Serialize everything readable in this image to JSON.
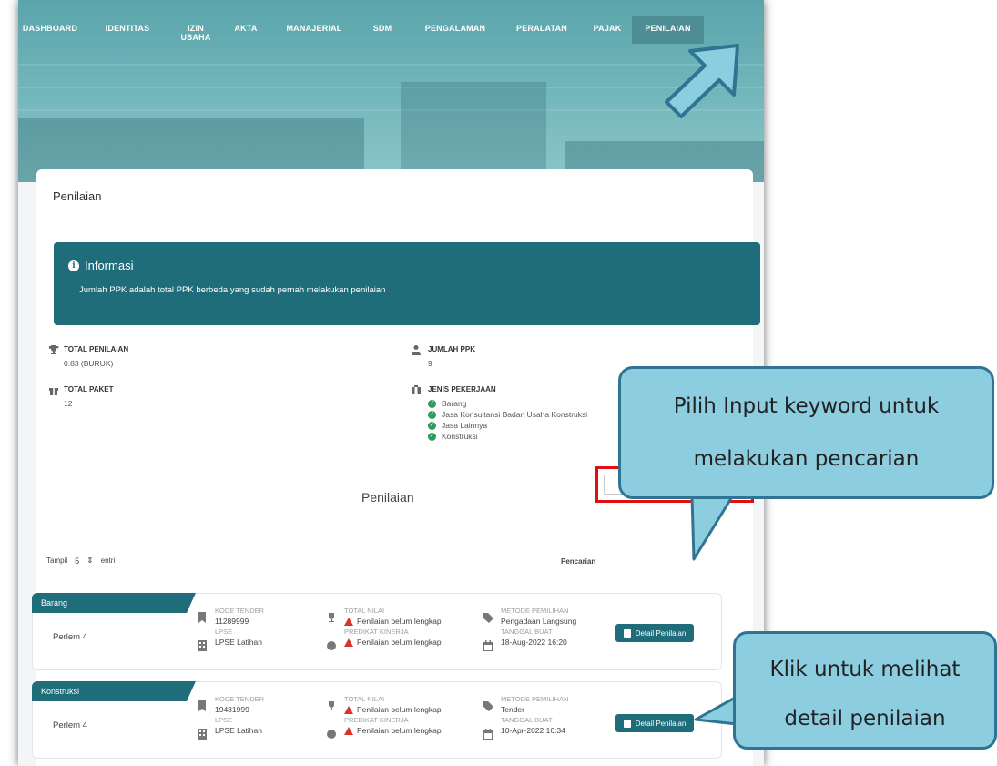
{
  "nav": {
    "items": [
      "DASHBOARD",
      "IDENTITAS",
      "IZIN\nUSAHA",
      "AKTA",
      "MANAJERIAL",
      "SDM",
      "PENGALAMAN",
      "PERALATAN",
      "PAJAK",
      "PENILAIAN"
    ],
    "active": "PENILAIAN"
  },
  "panel": {
    "title": "Penilaian"
  },
  "info": {
    "title": "Informasi",
    "text": "Jumlah PPK adalah total PPK berbeda yang sudah pernah melakukan penilaian"
  },
  "stats": {
    "total_penilaian_label": "TOTAL PENILAIAN",
    "total_penilaian_value": "0.83 (BURUK)",
    "jumlah_ppk_label": "JUMLAH PPK",
    "jumlah_ppk_value": "9",
    "total_paket_label": "TOTAL PAKET",
    "total_paket_value": "12",
    "jenis_label": "JENIS PEKERJAAN",
    "jenis_items": [
      "Barang",
      "Jasa Konsultansi Badan Usaha Konstruksi",
      "Jasa Lainnya",
      "Konstruksi"
    ]
  },
  "section": {
    "title": "Penilaian",
    "show_label": "Tampil",
    "show_value": "5",
    "show_suffix": "entri",
    "search_label": "Pencarian",
    "search_value": ""
  },
  "cards": [
    {
      "category": "Barang",
      "package": "Perlem 4",
      "kode_label": "KODE TENDER",
      "kode_value": "11289999",
      "lpse_label": "LPSE",
      "lpse_value": "LPSE Latihan",
      "nilai_label": "TOTAL NILAI",
      "nilai_value": "Penilaian belum lengkap",
      "predikat_label": "PREDIKAT KINERJA",
      "predikat_value": "Penilaian belum lengkap",
      "metode_label": "METODE PEMILIHAN",
      "metode_value": "Pengadaan Langsung",
      "tanggal_label": "TANGGAL BUAT",
      "tanggal_value": "18-Aug-2022 16:20",
      "button": "Detail Penilaian"
    },
    {
      "category": "Konstruksi",
      "package": "Perlem 4",
      "kode_label": "KODE TENDER",
      "kode_value": "19481999",
      "lpse_label": "LPSE",
      "lpse_value": "LPSE Latihan",
      "nilai_label": "TOTAL NILAI",
      "nilai_value": "Penilaian belum lengkap",
      "predikat_label": "PREDIKAT KINERJA",
      "predikat_value": "Penilaian belum lengkap",
      "metode_label": "METODE PEMILIHAN",
      "metode_value": "Tender",
      "tanggal_label": "TANGGAL BUAT",
      "tanggal_value": "10-Apr-2022 16:34",
      "button": "Detail Penilaian"
    }
  ],
  "callouts": {
    "search": {
      "line1": "Pilih Input keyword untuk",
      "line2": "melakukan pencarian"
    },
    "detail": {
      "line1": "Klik untuk melihat",
      "line2": "detail penilaian"
    }
  },
  "colors": {
    "teal": "#1f6c7a",
    "banner": "#6fb4b9",
    "callout_fill": "#8dcde0",
    "callout_border": "#2f7593",
    "highlight": "#e01010"
  }
}
